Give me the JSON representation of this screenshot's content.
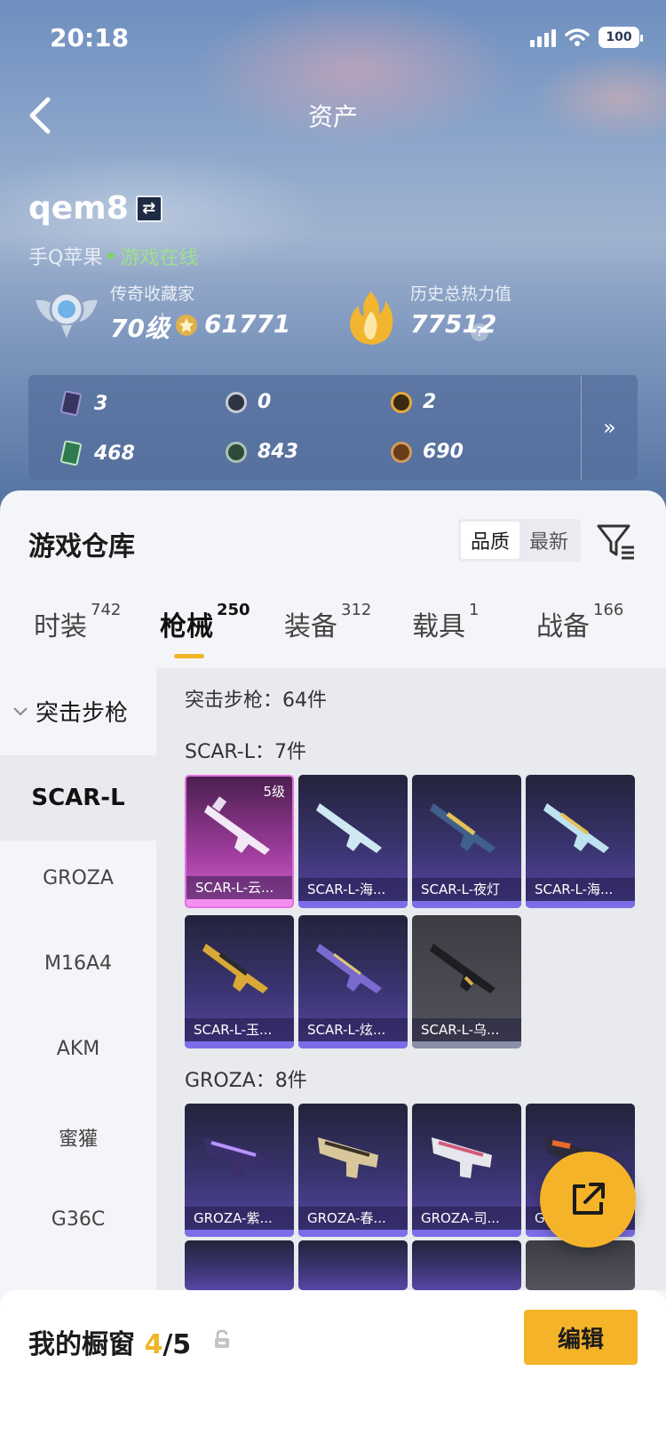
{
  "status_bar": {
    "time": "20:18",
    "battery": "100"
  },
  "header": {
    "title": "资产"
  },
  "profile": {
    "username": "qem8",
    "platform": "手Q苹果",
    "status": "游戏在线",
    "rank_label": "传奇收藏家",
    "level": "70级",
    "score": "61771",
    "heat_label": "历史总热力值",
    "heat_value": "77512"
  },
  "stats": [
    {
      "icon": "card-icon",
      "value": "3"
    },
    {
      "icon": "coin-icon",
      "value": "0"
    },
    {
      "icon": "gold-coin-icon",
      "value": "2"
    },
    {
      "icon": "ticket-icon",
      "value": "468"
    },
    {
      "icon": "green-coin-icon",
      "value": "843"
    },
    {
      "icon": "bronze-coin-icon",
      "value": "690"
    }
  ],
  "warehouse": {
    "title": "游戏仓库",
    "sort_options": [
      "品质",
      "最新"
    ],
    "tabs": [
      {
        "label": "时装",
        "count": "742"
      },
      {
        "label": "枪械",
        "count": "250"
      },
      {
        "label": "装备",
        "count": "312"
      },
      {
        "label": "载具",
        "count": "1"
      },
      {
        "label": "战备",
        "count": "166"
      }
    ]
  },
  "sidebar": {
    "category": "突击步枪",
    "items": [
      "SCAR-L",
      "GROZA",
      "M16A4",
      "AKM",
      "蜜獾",
      "G36C"
    ]
  },
  "content": {
    "category_title": "突击步枪：64件",
    "groups": [
      {
        "title": "SCAR-L：7件",
        "items": [
          "SCAR-L-云...",
          "SCAR-L-海...",
          "SCAR-L-夜灯",
          "SCAR-L-海...",
          "SCAR-L-玉...",
          "SCAR-L-炫...",
          "SCAR-L-乌..."
        ]
      },
      {
        "title": "GROZA：8件",
        "items": [
          "GROZA-紫...",
          "GROZA-春...",
          "GROZA-司...",
          "G"
        ]
      }
    ],
    "level_badge": "5级"
  },
  "footer": {
    "title": "我的橱窗",
    "count_current": "4",
    "count_total": "/5",
    "edit_label": "编辑"
  },
  "colors": {
    "accent": "#f4b329",
    "tab_underline": "#f0b526",
    "online": "#7fd26a"
  }
}
